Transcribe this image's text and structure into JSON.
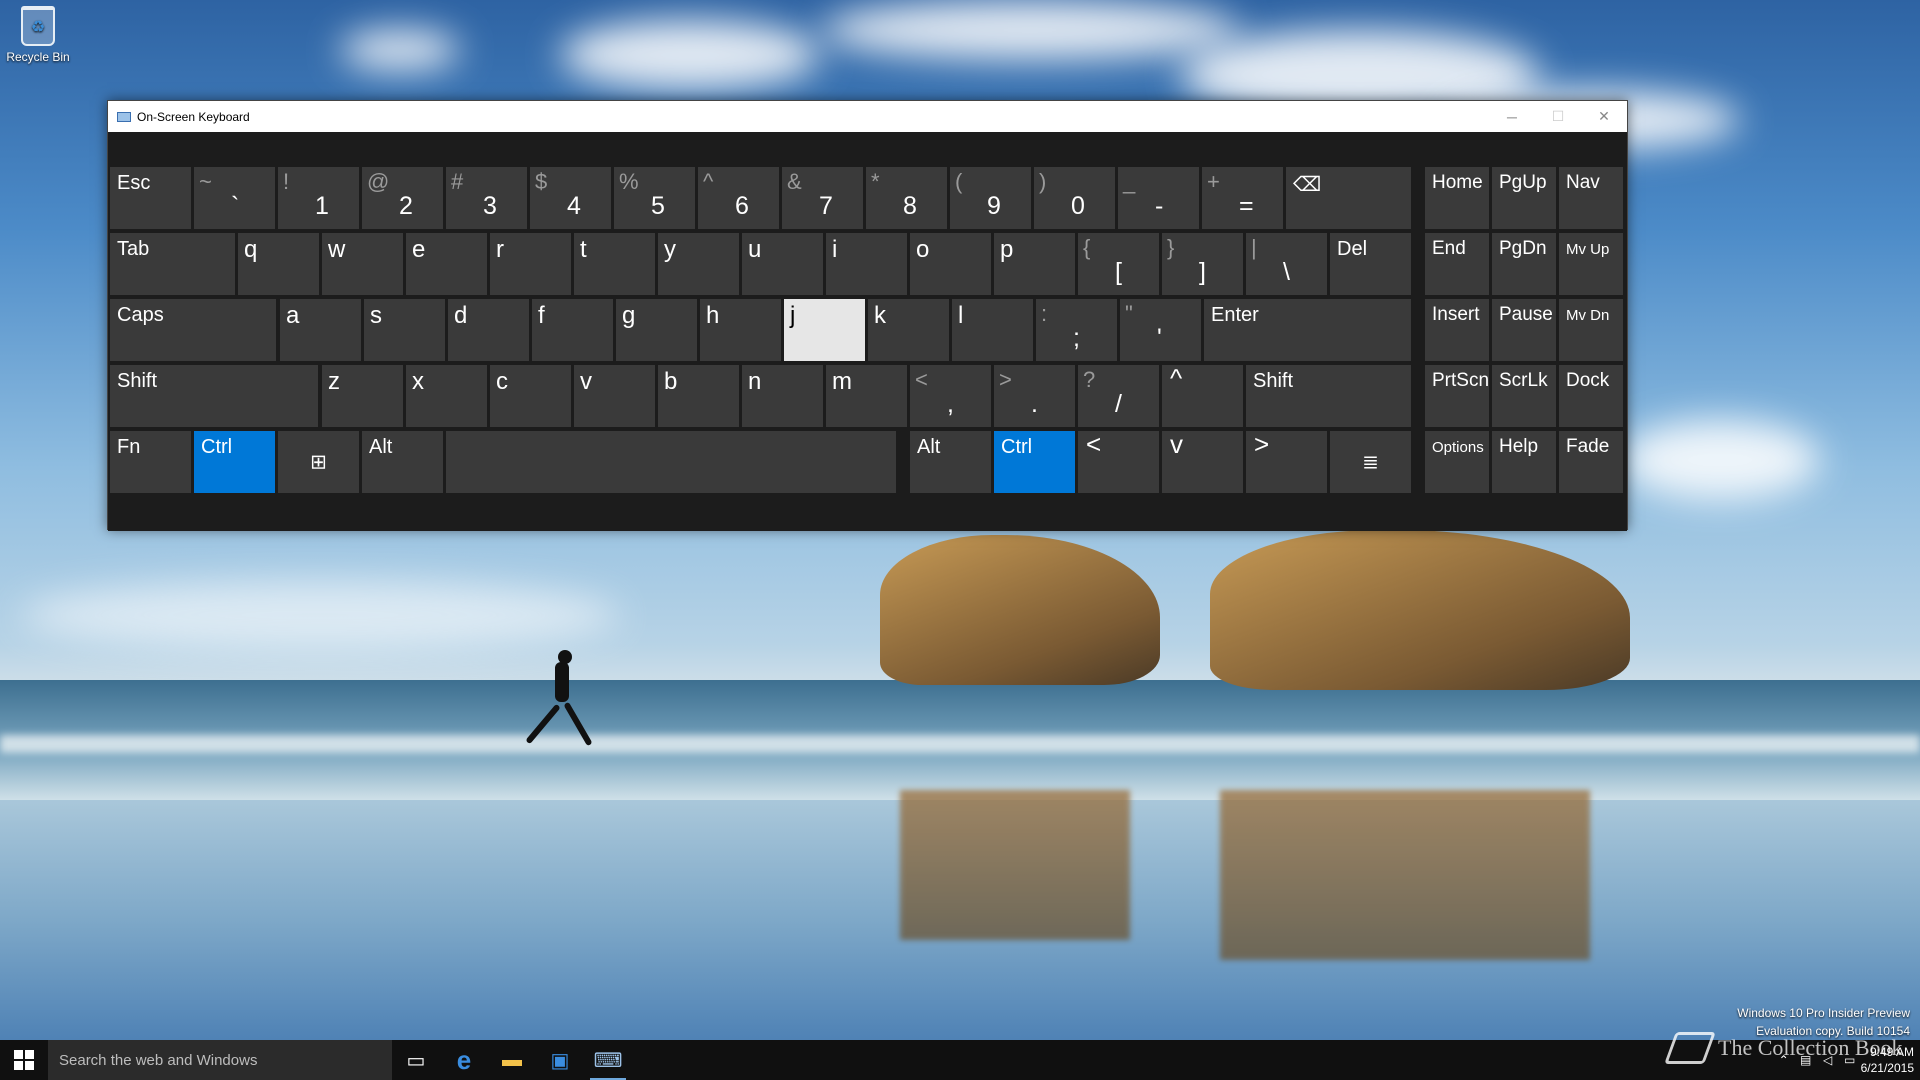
{
  "desktop": {
    "recycle_bin_label": "Recycle Bin",
    "watermark_line1": "Windows 10 Pro Insider Preview",
    "watermark_line2": "Evaluation copy. Build 10154",
    "brand_text": "The Collection Book"
  },
  "window": {
    "title": "On-Screen Keyboard",
    "minimize_icon": "minimize-icon",
    "maximize_icon": "maximize-icon",
    "close_icon": "close-icon"
  },
  "keyboard": {
    "row1": [
      {
        "id": "esc",
        "label": "Esc"
      },
      {
        "id": "backtick",
        "up": "~",
        "dn": "`"
      },
      {
        "id": "1",
        "up": "!",
        "dn": "1"
      },
      {
        "id": "2",
        "up": "@",
        "dn": "2"
      },
      {
        "id": "3",
        "up": "#",
        "dn": "3"
      },
      {
        "id": "4",
        "up": "$",
        "dn": "4"
      },
      {
        "id": "5",
        "up": "%",
        "dn": "5"
      },
      {
        "id": "6",
        "up": "^",
        "dn": "6"
      },
      {
        "id": "7",
        "up": "&",
        "dn": "7"
      },
      {
        "id": "8",
        "up": "*",
        "dn": "8"
      },
      {
        "id": "9",
        "up": "(",
        "dn": "9"
      },
      {
        "id": "0",
        "up": ")",
        "dn": "0"
      },
      {
        "id": "minus",
        "up": "_",
        "dn": "-"
      },
      {
        "id": "equals",
        "up": "+",
        "dn": "="
      },
      {
        "id": "backspace",
        "icon": "backspace-icon",
        "label": "⌫"
      }
    ],
    "row2": [
      {
        "id": "tab",
        "label": "Tab"
      },
      {
        "id": "q",
        "label": "q"
      },
      {
        "id": "w",
        "label": "w"
      },
      {
        "id": "e",
        "label": "e"
      },
      {
        "id": "r",
        "label": "r"
      },
      {
        "id": "t",
        "label": "t"
      },
      {
        "id": "y",
        "label": "y"
      },
      {
        "id": "u",
        "label": "u"
      },
      {
        "id": "i",
        "label": "i"
      },
      {
        "id": "o",
        "label": "o"
      },
      {
        "id": "p",
        "label": "p"
      },
      {
        "id": "lbracket",
        "up": "{",
        "dn": "["
      },
      {
        "id": "rbracket",
        "up": "}",
        "dn": "]"
      },
      {
        "id": "backslash",
        "up": "|",
        "dn": "\\"
      },
      {
        "id": "del",
        "label": "Del"
      }
    ],
    "row3": [
      {
        "id": "caps",
        "label": "Caps"
      },
      {
        "id": "a",
        "label": "a"
      },
      {
        "id": "s",
        "label": "s"
      },
      {
        "id": "d",
        "label": "d"
      },
      {
        "id": "f",
        "label": "f"
      },
      {
        "id": "g",
        "label": "g"
      },
      {
        "id": "h",
        "label": "h"
      },
      {
        "id": "j",
        "label": "j",
        "state": "pressed"
      },
      {
        "id": "k",
        "label": "k"
      },
      {
        "id": "l",
        "label": "l"
      },
      {
        "id": "semicolon",
        "up": ":",
        "dn": ";"
      },
      {
        "id": "quote",
        "up": "\"",
        "dn": "'"
      },
      {
        "id": "enter",
        "label": "Enter"
      }
    ],
    "row4": [
      {
        "id": "shift-left",
        "label": "Shift"
      },
      {
        "id": "z",
        "label": "z"
      },
      {
        "id": "x",
        "label": "x"
      },
      {
        "id": "c",
        "label": "c"
      },
      {
        "id": "v",
        "label": "v"
      },
      {
        "id": "b",
        "label": "b"
      },
      {
        "id": "n",
        "label": "n"
      },
      {
        "id": "m",
        "label": "m"
      },
      {
        "id": "comma",
        "up": "<",
        "dn": ","
      },
      {
        "id": "period",
        "up": ">",
        "dn": "."
      },
      {
        "id": "slash",
        "up": "?",
        "dn": "/"
      },
      {
        "id": "up-arrow",
        "icon": "chevron-up-icon",
        "label": "^"
      },
      {
        "id": "shift-right",
        "label": "Shift"
      }
    ],
    "row5": [
      {
        "id": "fn",
        "label": "Fn"
      },
      {
        "id": "ctrl-left",
        "label": "Ctrl",
        "state": "active"
      },
      {
        "id": "win",
        "icon": "windows-logo-icon",
        "label": "⊞"
      },
      {
        "id": "alt-left",
        "label": "Alt"
      },
      {
        "id": "space",
        "label": ""
      },
      {
        "id": "alt-right",
        "label": "Alt"
      },
      {
        "id": "ctrl-right",
        "label": "Ctrl",
        "state": "active"
      },
      {
        "id": "left-arrow",
        "icon": "chevron-left-icon",
        "label": "<"
      },
      {
        "id": "down-arrow",
        "icon": "chevron-down-icon",
        "label": "v"
      },
      {
        "id": "right-arrow",
        "icon": "chevron-right-icon",
        "label": ">"
      },
      {
        "id": "menu",
        "icon": "context-menu-icon",
        "label": "≣"
      }
    ],
    "nav": [
      {
        "id": "home",
        "label": "Home"
      },
      {
        "id": "pgup",
        "label": "PgUp"
      },
      {
        "id": "nav",
        "label": "Nav"
      },
      {
        "id": "end",
        "label": "End"
      },
      {
        "id": "pgdn",
        "label": "PgDn"
      },
      {
        "id": "mvup",
        "label": "Mv Up"
      },
      {
        "id": "insert",
        "label": "Insert"
      },
      {
        "id": "pause",
        "label": "Pause"
      },
      {
        "id": "mvdn",
        "label": "Mv Dn"
      },
      {
        "id": "prtscn",
        "label": "PrtScn"
      },
      {
        "id": "scrlk",
        "label": "ScrLk"
      },
      {
        "id": "dock",
        "label": "Dock"
      },
      {
        "id": "options",
        "label": "Options"
      },
      {
        "id": "help",
        "label": "Help"
      },
      {
        "id": "fade",
        "label": "Fade"
      }
    ],
    "colors": {
      "key": "#3a3a3a",
      "active": "#0078d7",
      "pressed": "#e6e6e6",
      "panel": "#1c1c1c"
    }
  },
  "taskbar": {
    "search_placeholder": "Search the web and Windows",
    "icons": [
      "task-view-icon",
      "edge-icon",
      "file-explorer-icon",
      "store-icon",
      "on-screen-keyboard-icon"
    ],
    "clock_time": "9:49 AM",
    "clock_date": "6/21/2015",
    "tray_icons": [
      "chevron-up-icon",
      "network-icon",
      "volume-icon",
      "action-center-icon"
    ]
  }
}
